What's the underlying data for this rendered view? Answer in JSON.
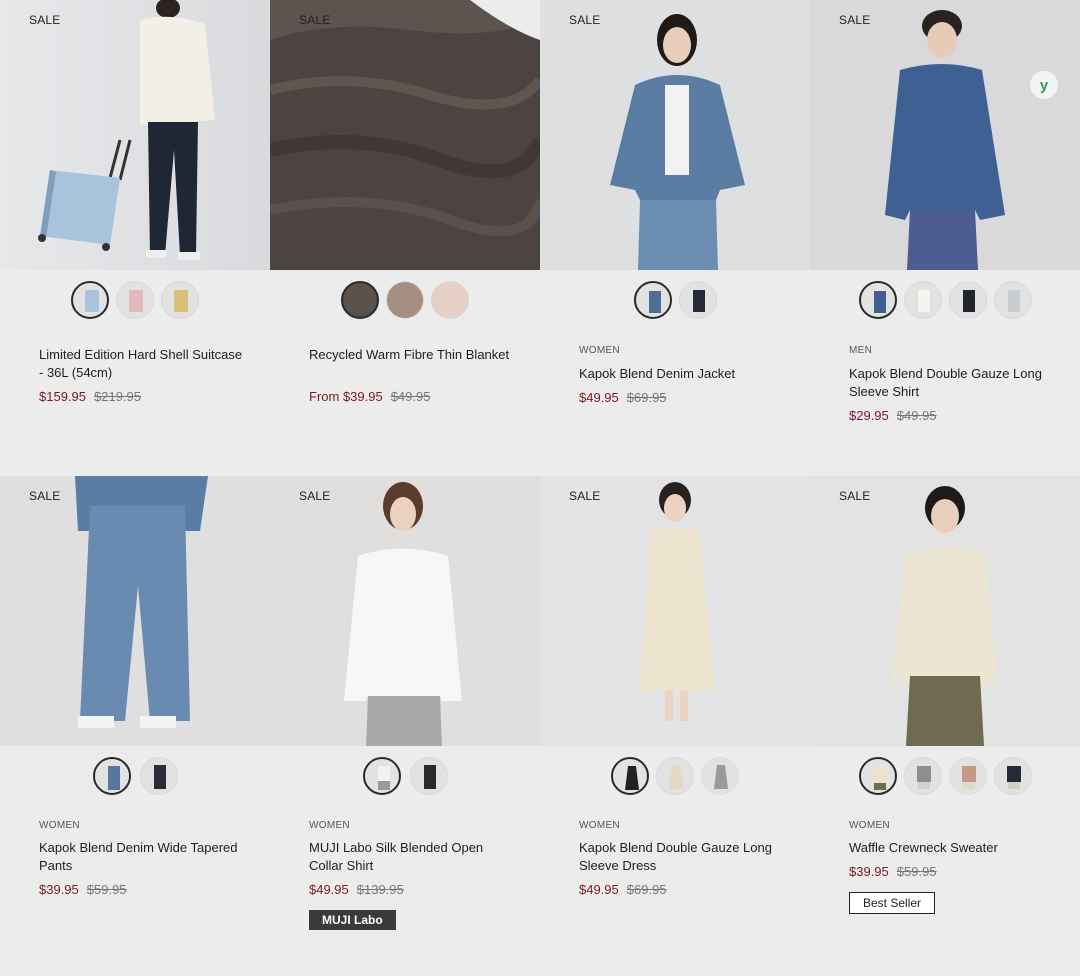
{
  "products": [
    {
      "sale": "SALE",
      "category": "",
      "name": "Limited Edition Hard Shell Suitcase - 36L (54cm)",
      "price": "$159.95",
      "was": "$219.95",
      "swatch_colors": [
        "#a9c3dc",
        "#e2b8bd",
        "#d9c07a"
      ]
    },
    {
      "sale": "SALE",
      "category": "",
      "name": "Recycled Warm Fibre Thin Blanket",
      "price": "From $39.95",
      "was": "$49.95",
      "swatch_colors": [
        "#5a514a",
        "#a48f80",
        "#e5cfc6"
      ]
    },
    {
      "sale": "SALE",
      "category": "WOMEN",
      "name": "Kapok Blend Denim Jacket",
      "price": "$49.95",
      "was": "$69.95",
      "swatch_colors": [
        "#4f6e93",
        "#262a36"
      ]
    },
    {
      "sale": "SALE",
      "category": "MEN",
      "name": "Kapok Blend Double Gauze Long Sleeve Shirt",
      "price": "$29.95",
      "was": "$49.95",
      "swatch_colors": [
        "#3e5f8f",
        "#e8e6df",
        "#22252b",
        "#c9ccd0"
      ]
    },
    {
      "sale": "SALE",
      "category": "WOMEN",
      "name": "Kapok Blend Denim Wide Tapered Pants",
      "price": "$39.95",
      "was": "$59.95",
      "swatch_colors": [
        "#56779c",
        "#2b2d34"
      ]
    },
    {
      "sale": "SALE",
      "category": "WOMEN",
      "name": "MUJI Labo Silk Blended Open Collar Shirt",
      "price": "$49.95",
      "was": "$139.95",
      "swatch_colors": [
        "#f2f2ef",
        "#2a2a2d"
      ],
      "tag": "MUJI Labo"
    },
    {
      "sale": "SALE",
      "category": "WOMEN",
      "name": "Kapok Blend Double Gauze Long Sleeve Dress",
      "price": "$49.95",
      "was": "$69.95",
      "swatch_colors": [
        "#222222",
        "#e3d9c3",
        "#9a9a9a"
      ]
    },
    {
      "sale": "SALE",
      "category": "WOMEN",
      "name": "Waffle Crewneck Sweater",
      "price": "$39.95",
      "was": "$59.95",
      "swatch_colors": [
        "#ebe3d1",
        "#8e8e8e",
        "#c39a86",
        "#262b3a"
      ],
      "tag": "Best Seller"
    }
  ],
  "badge_icon": "y",
  "colors": {
    "sale_price": "#7a1823",
    "page_bg": "#ececec"
  }
}
